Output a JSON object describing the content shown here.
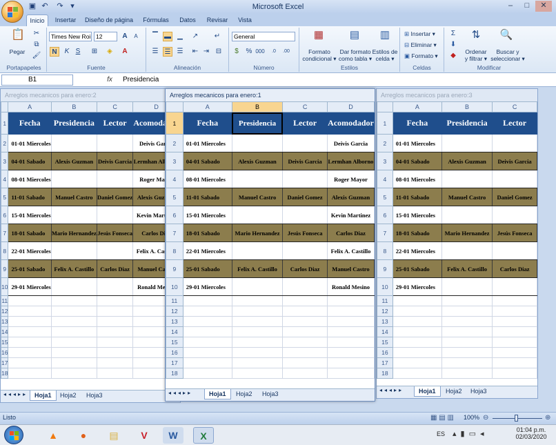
{
  "app": {
    "title": "Microsoft Excel",
    "window_buttons": [
      "–",
      "□",
      "✕"
    ]
  },
  "ribbon_tabs": [
    "Inicio",
    "Insertar",
    "Diseño de página",
    "Fórmulas",
    "Datos",
    "Revisar",
    "Vista"
  ],
  "ribbon": {
    "groups": [
      "Portapapeles",
      "Fuente",
      "Alineación",
      "Número",
      "Estilos",
      "Celdas",
      "Modificar"
    ],
    "paste": "Pegar",
    "font_name": "Times New Roi",
    "font_size": "12",
    "number_format": "General",
    "formato_condicional": [
      "Formato",
      "condicional ▾"
    ],
    "dar_formato": [
      "Dar formato",
      "como tabla ▾"
    ],
    "estilos_celda": [
      "Estilos de",
      "celda ▾"
    ],
    "insertar": "Insertar ▾",
    "eliminar": "Eliminar ▾",
    "formato": "Formato ▾",
    "ordenar": [
      "Ordenar",
      "y filtrar ▾"
    ],
    "buscar": [
      "Buscar y",
      "seleccionar ▾"
    ]
  },
  "formula_bar": {
    "cell_ref": "B1",
    "fx": "fx",
    "value": "Presidencia"
  },
  "windows": [
    {
      "title": "Arreglos mecanicos para enero:2"
    },
    {
      "title": "Arreglos mecanicos para enero:1"
    },
    {
      "title": "Arreglos mecanicos para enero:3"
    }
  ],
  "sheet": {
    "columns": [
      "A",
      "B",
      "C",
      "D"
    ],
    "headers": [
      "Fecha",
      "Presidencia",
      "Lector",
      "Acomodador"
    ],
    "rows": [
      {
        "fecha": "01-01 Miercoles",
        "presidencia": "",
        "lector": "",
        "acomodador": "Deivis Garcia"
      },
      {
        "fecha": "04-01 Sabado",
        "presidencia": "Alexis Guzman",
        "lector": "Deivis Garcia",
        "acomodador": "Lermhan Alborno"
      },
      {
        "fecha": "08-01 Miercoles",
        "presidencia": "",
        "lector": "",
        "acomodador": "Roger Mayor"
      },
      {
        "fecha": "11-01 Sabado",
        "presidencia": "Manuel Castro",
        "lector": "Daniel Gomez",
        "acomodador": "Alexis Guzman"
      },
      {
        "fecha": "15-01 Miercoles",
        "presidencia": "",
        "lector": "",
        "acomodador": "Kevin Martinez"
      },
      {
        "fecha": "18-01 Sabado",
        "presidencia": "Mario Hernandez",
        "lector": "Jesús Fonseca",
        "acomodador": "Carlos Diaz"
      },
      {
        "fecha": "22-01 Miercoles",
        "presidencia": "",
        "lector": "",
        "acomodador": "Felix A. Castillo"
      },
      {
        "fecha": "25-01 Sabado",
        "presidencia": "Felix A. Castillo",
        "lector": "Carlos Diaz",
        "acomodador": "Manuel Castro"
      },
      {
        "fecha": "29-01 Miercoles",
        "presidencia": "",
        "lector": "",
        "acomodador": "Ronald Mesino"
      }
    ],
    "row_numbers": [
      "1",
      "2",
      "3",
      "4",
      "5",
      "6",
      "7",
      "8",
      "9",
      "10",
      "11",
      "12",
      "13",
      "14",
      "15",
      "16",
      "17",
      "18"
    ],
    "sheet_tabs": [
      "Hoja1",
      "Hoja2",
      "Hoja3"
    ]
  },
  "status": {
    "mode": "Listo",
    "zoom": "100%"
  },
  "taskbar": {
    "lang": "ES",
    "time": "01:04 p.m.",
    "date": "02/03/2020"
  },
  "colors": {
    "header_blue": "#1f4e8c",
    "olive": "#8c7d4d",
    "selection": "#f8d590"
  }
}
